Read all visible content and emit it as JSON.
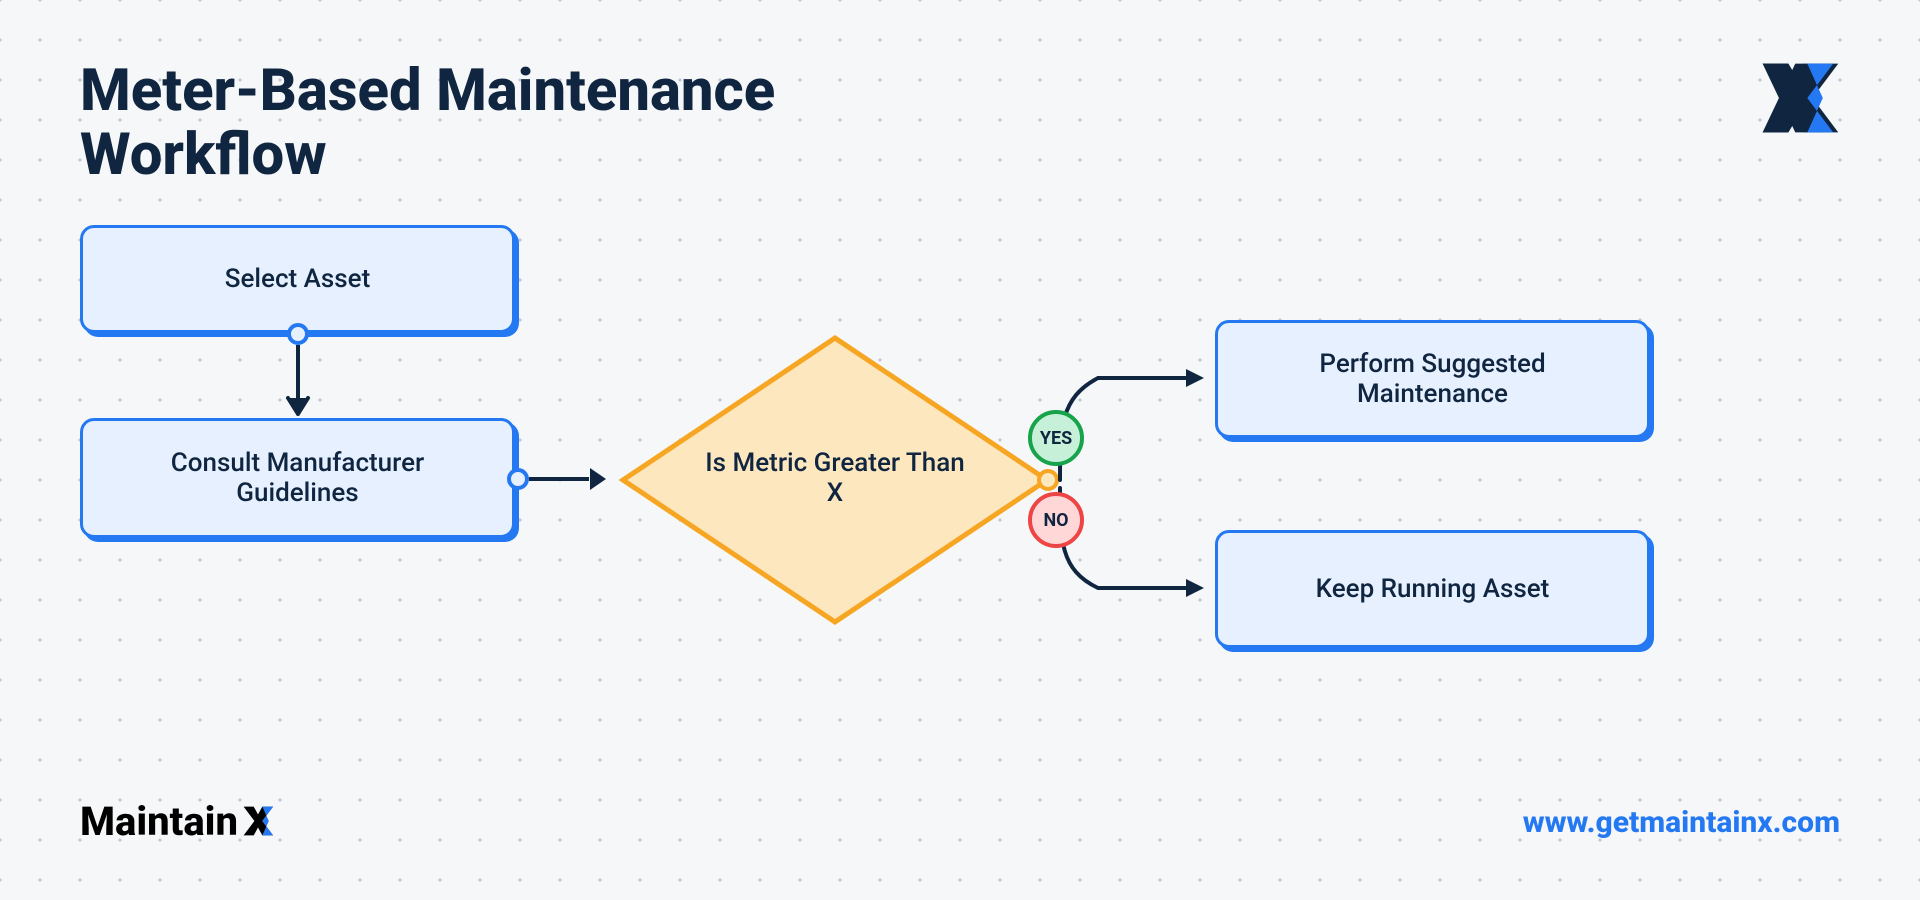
{
  "title": "Meter-Based Maintenance Workflow",
  "nodes": {
    "select_asset": "Select Asset",
    "consult_guidelines": "Consult Manufacturer Guidelines",
    "perform_maintenance": "Perform Suggested Maintenance",
    "keep_running": "Keep Running Asset"
  },
  "decision": "Is Metric Greater Than X",
  "badges": {
    "yes": "YES",
    "no": "NO"
  },
  "brand": "Maintain",
  "url": "www.getmaintainx.com"
}
